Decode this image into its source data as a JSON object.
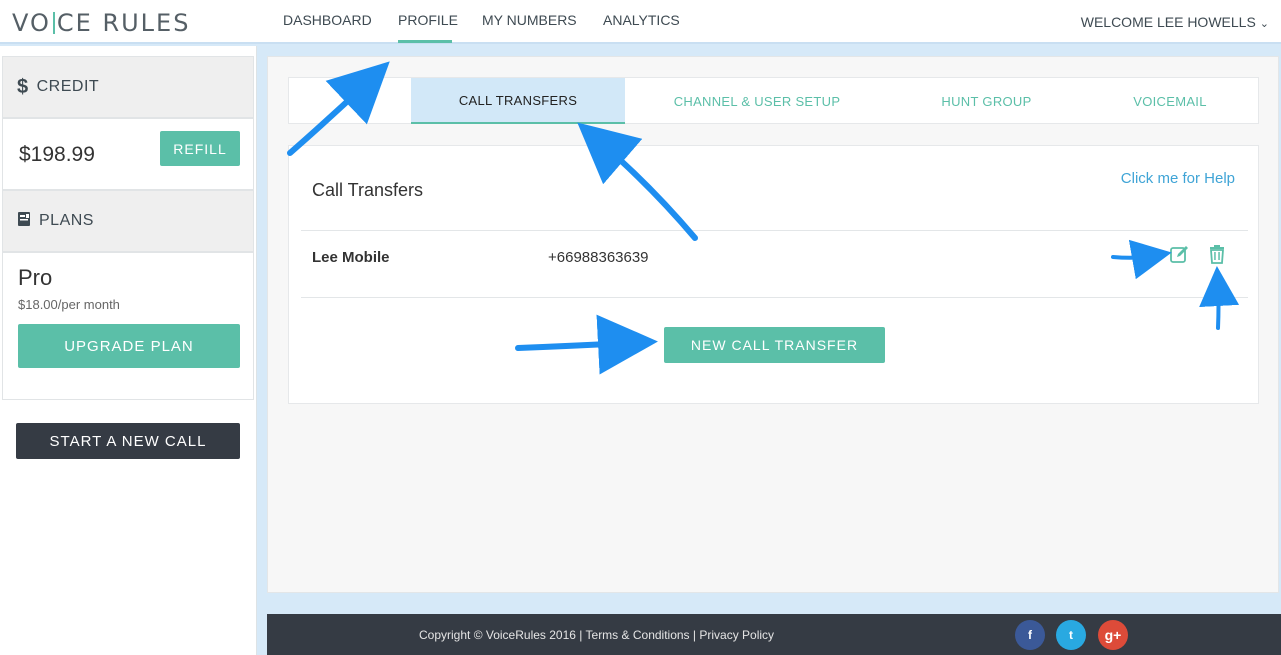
{
  "brand": {
    "logo_left": "VO",
    "logo_right": "CE RULES"
  },
  "nav": {
    "items": [
      {
        "label": "DASHBOARD"
      },
      {
        "label": "PROFILE"
      },
      {
        "label": "MY NUMBERS"
      },
      {
        "label": "ANALYTICS"
      }
    ],
    "active": "PROFILE",
    "welcome": "WELCOME LEE HOWELLS"
  },
  "sidebar": {
    "credit": {
      "heading": "CREDIT",
      "amount": "$198.99",
      "refill_label": "REFILL"
    },
    "plans": {
      "heading": "PLANS",
      "plan_name": "Pro",
      "plan_price": "$18.00/per month",
      "upgrade_label": "UPGRADE PLAN"
    },
    "start_call_label": "START A NEW CALL"
  },
  "tabs": [
    {
      "label": "CALL TRANSFERS",
      "active": true
    },
    {
      "label": "CHANNEL & USER SETUP",
      "active": false
    },
    {
      "label": "HUNT GROUP",
      "active": false
    },
    {
      "label": "VOICEMAIL",
      "active": false
    }
  ],
  "panel": {
    "title": "Call Transfers",
    "help_link": "Click me for Help",
    "transfers": [
      {
        "name": "Lee Mobile",
        "number": "+66988363639"
      }
    ],
    "new_transfer_label": "NEW CALL TRANSFER"
  },
  "footer": {
    "copyright": "Copyright © VoiceRules 2016",
    "terms": "Terms & Conditions",
    "privacy": "Privacy Policy",
    "social": [
      {
        "name": "facebook-icon",
        "glyph": "f",
        "color": "#3b5998"
      },
      {
        "name": "twitter-icon",
        "glyph": "t",
        "color": "#29a9e1"
      },
      {
        "name": "google-plus-icon",
        "glyph": "g+",
        "color": "#dd4b39"
      }
    ]
  },
  "colors": {
    "accent": "#5bbfa8",
    "dark": "#353b44",
    "link": "#3fa4d6",
    "arrow": "#1e8ef0"
  }
}
